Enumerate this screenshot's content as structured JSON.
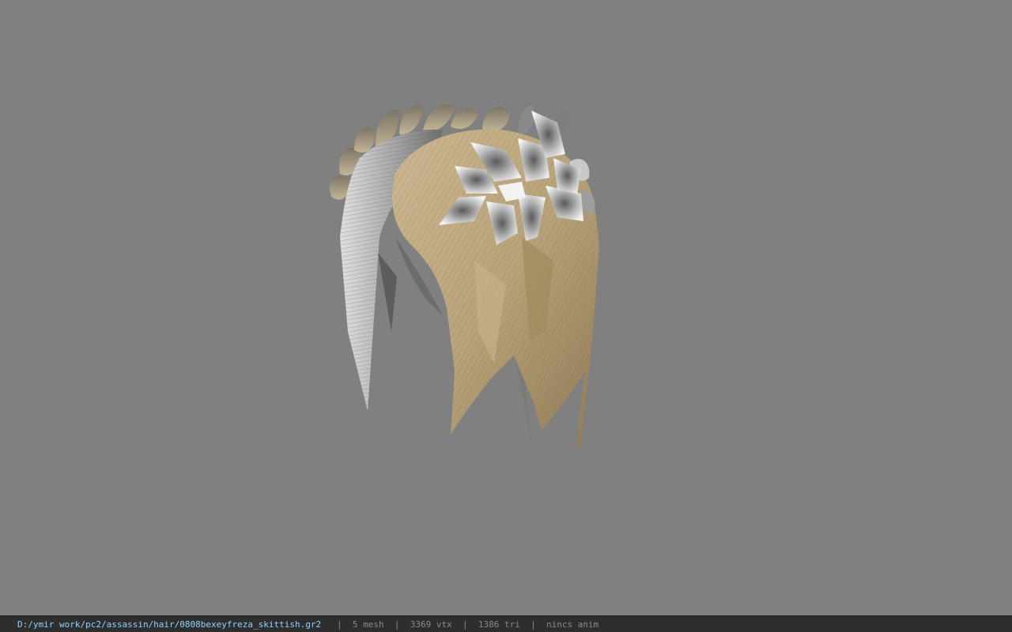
{
  "viewer": {
    "background_color": "#808080",
    "model": {
      "name": "hair model with leaf crown",
      "hair_color": "#b9a37a",
      "hair_shadow_color": "#9f8a60",
      "grey_hair_color": "#b9b9b9",
      "leaf_crown_color": "#b3a58a",
      "flower_color": "#d9d9d9"
    }
  },
  "status_bar": {
    "file_path": "D:/ymir work/pc2/assassin/hair/0808bexeyfreza_skittish.gr2",
    "separator": "|",
    "mesh_count": "5 mesh",
    "vertex_count": "3369 vtx",
    "triangle_count": "1386 tri",
    "anim_status": "nincs anim"
  }
}
